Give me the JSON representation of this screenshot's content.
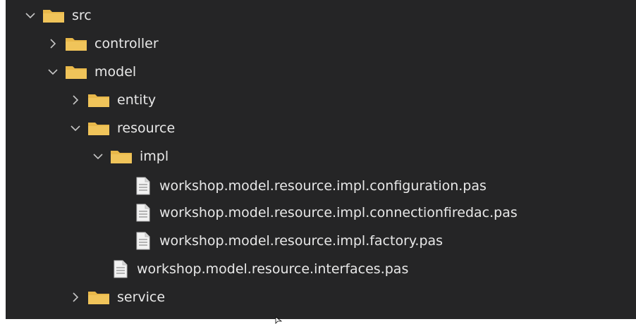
{
  "explorer": {
    "items": [
      {
        "label": "src",
        "kind": "folder",
        "expanded": true,
        "icon": "chevron-down-icon"
      },
      {
        "label": "controller",
        "kind": "folder",
        "expanded": false,
        "icon": "chevron-right-icon"
      },
      {
        "label": "model",
        "kind": "folder",
        "expanded": true,
        "icon": "chevron-down-icon"
      },
      {
        "label": "entity",
        "kind": "folder",
        "expanded": false,
        "icon": "chevron-right-icon"
      },
      {
        "label": "resource",
        "kind": "folder",
        "expanded": true,
        "icon": "chevron-down-icon"
      },
      {
        "label": "impl",
        "kind": "folder",
        "expanded": true,
        "icon": "chevron-down-icon"
      },
      {
        "label": "workshop.model.resource.impl.configuration.pas",
        "kind": "file",
        "icon": "file-icon"
      },
      {
        "label": "workshop.model.resource.impl.connectionfiredac.pas",
        "kind": "file",
        "icon": "file-icon"
      },
      {
        "label": "workshop.model.resource.impl.factory.pas",
        "kind": "file",
        "icon": "file-icon"
      },
      {
        "label": "workshop.model.resource.interfaces.pas",
        "kind": "file",
        "icon": "file-icon"
      },
      {
        "label": "service",
        "kind": "folder",
        "expanded": false,
        "icon": "chevron-right-icon"
      }
    ]
  },
  "colors": {
    "background": "#252526",
    "text": "#e8e8e8",
    "folder": "#e8b84a",
    "chevron": "#c5c5c5"
  }
}
